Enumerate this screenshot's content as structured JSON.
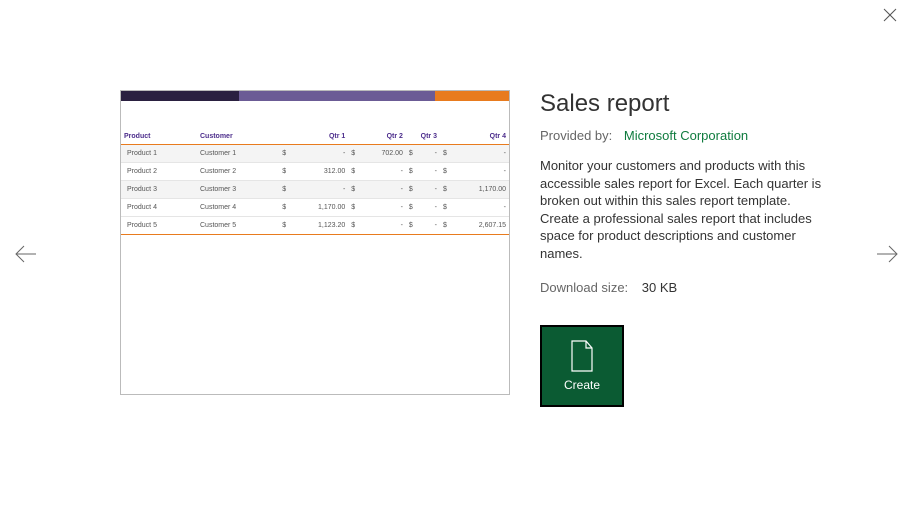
{
  "title": "Sales report",
  "provided_label": "Provided by:",
  "provider": "Microsoft Corporation",
  "description": "Monitor your customers and products with this accessible sales report for Excel. Each quarter is broken out within this sales report template. Create a professional sales report that includes space for product descriptions and customer names.",
  "download_label": "Download size:",
  "download_size": "30 KB",
  "create_label": "Create",
  "preview": {
    "headers": {
      "product": "Product",
      "customer": "Customer",
      "q1": "Qtr 1",
      "q2": "Qtr 2",
      "q3": "Qtr 3",
      "q4": "Qtr 4"
    },
    "rows": [
      {
        "product": "Product 1",
        "customer": "Customer 1",
        "q1": "-",
        "q2": "702.00",
        "q3": "-",
        "q4": "-"
      },
      {
        "product": "Product 2",
        "customer": "Customer 2",
        "q1": "312.00",
        "q2": "-",
        "q3": "-",
        "q4": "-"
      },
      {
        "product": "Product 3",
        "customer": "Customer 3",
        "q1": "-",
        "q2": "-",
        "q3": "-",
        "q4": "1,170.00"
      },
      {
        "product": "Product 4",
        "customer": "Customer 4",
        "q1": "1,170.00",
        "q2": "-",
        "q3": "-",
        "q4": "-"
      },
      {
        "product": "Product 5",
        "customer": "Customer 5",
        "q1": "1,123.20",
        "q2": "-",
        "q3": "-",
        "q4": "2,607.15"
      }
    ]
  }
}
